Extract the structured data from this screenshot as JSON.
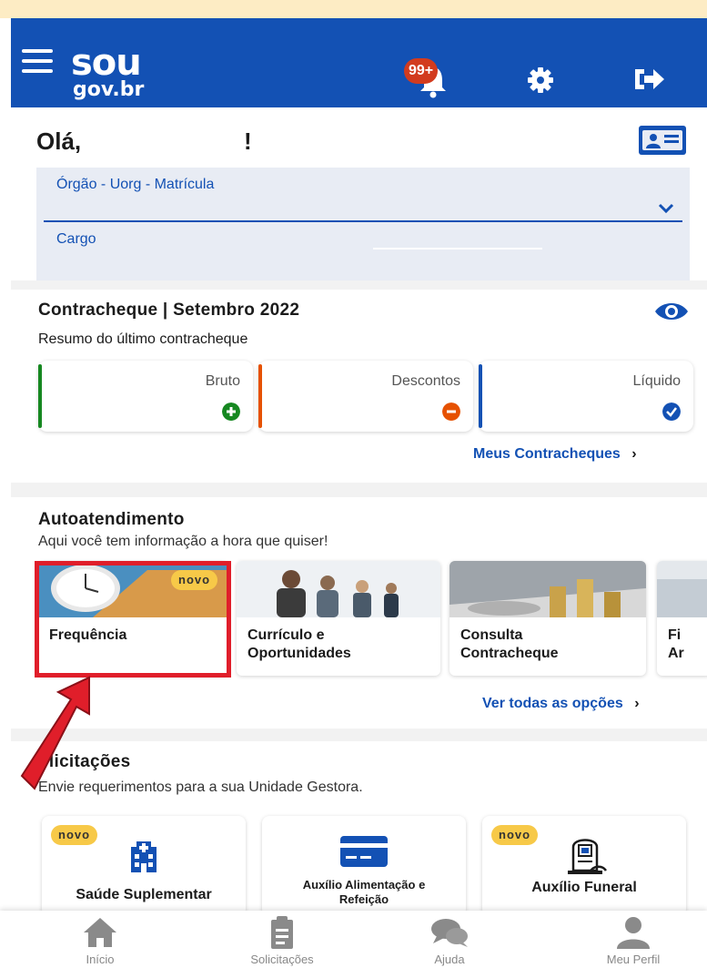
{
  "header": {
    "logo_top": "sou",
    "logo_bottom": "gov.br",
    "notification_badge": "99+"
  },
  "greeting": {
    "text": "Olá,",
    "suffix": "!"
  },
  "servant_info": {
    "org_label": "Órgão - Uorg - Matrícula",
    "cargo_label": "Cargo"
  },
  "paycheck": {
    "title": "Contracheque | Setembro 2022",
    "subtitle": "Resumo do último contracheque",
    "cards": [
      {
        "label": "Bruto",
        "icon": "plus-circle-icon",
        "color": "#168821"
      },
      {
        "label": "Descontos",
        "icon": "minus-circle-icon",
        "color": "#e65100"
      },
      {
        "label": "Líquido",
        "icon": "check-circle-icon",
        "color": "#1351b4"
      }
    ],
    "link": "Meus Contracheques"
  },
  "self_service": {
    "title": "Autoatendimento",
    "subtitle": "Aqui você tem informação a hora que quiser!",
    "cards": [
      {
        "title": "Frequência",
        "badge": "novo"
      },
      {
        "title_line1": "Currículo e",
        "title_line2": "Oportunidades"
      },
      {
        "title_line1": "Consulta",
        "title_line2": "Contracheque"
      },
      {
        "title_line1": "Fi",
        "title_line2": "Ar"
      }
    ],
    "link": "Ver todas as opções"
  },
  "requests": {
    "title": "olicitações",
    "subtitle": "Envie requerimentos para a sua Unidade Gestora.",
    "cards": [
      {
        "title": "Saúde Suplementar",
        "badge": "novo",
        "icon": "hospital-icon"
      },
      {
        "title_line1": "Auxílio Alimentação e",
        "title_line2": "Refeição",
        "icon": "card-icon"
      },
      {
        "title": "Auxílio Funeral",
        "badge": "novo",
        "icon": "funeral-icon"
      }
    ]
  },
  "bottom_nav": [
    {
      "label": "Início",
      "icon": "home-icon"
    },
    {
      "label": "Solicitações",
      "icon": "clipboard-icon"
    },
    {
      "label": "Ajuda",
      "icon": "chat-icon"
    },
    {
      "label": "Meu Perfil",
      "icon": "user-icon"
    }
  ],
  "colors": {
    "primary": "#1351b4",
    "highlight": "#e01e2a",
    "badge": "#f7c948"
  }
}
